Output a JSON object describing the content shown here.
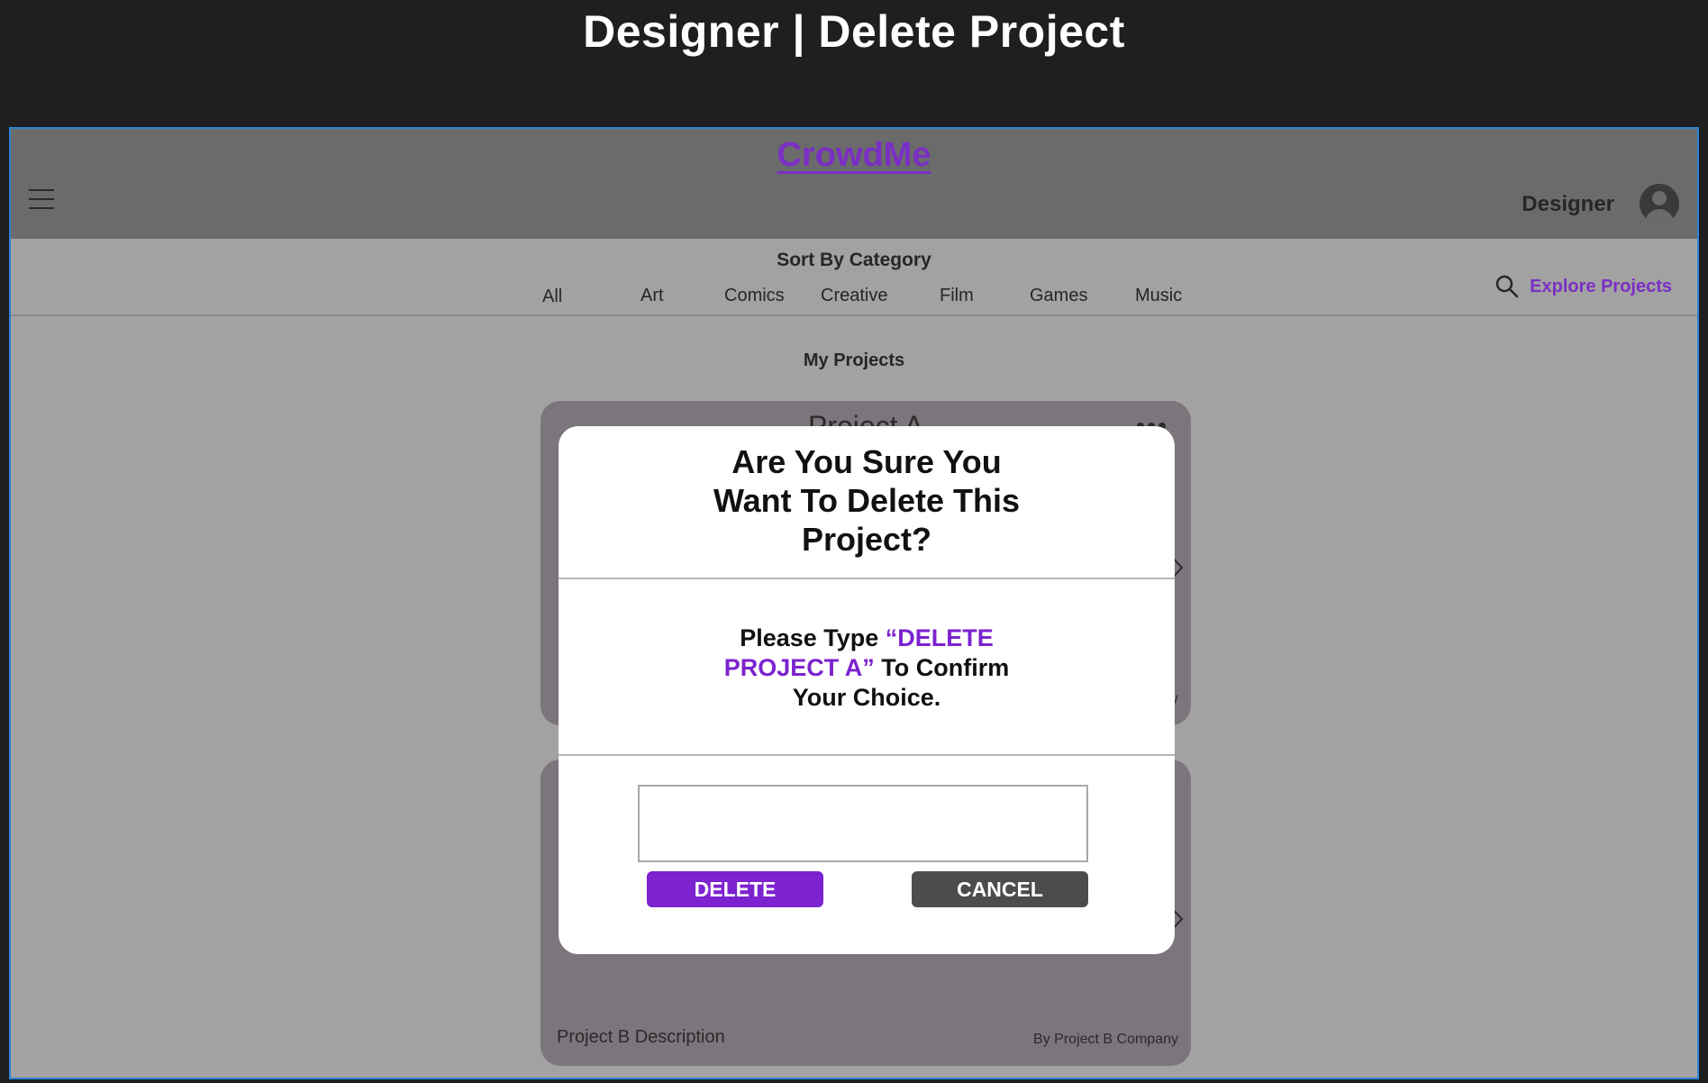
{
  "page_title": "Designer | Delete Project",
  "header": {
    "brand": "CrowdMe",
    "user_label": "Designer"
  },
  "categories": {
    "title": "Sort By Category",
    "items": [
      "All",
      "Art",
      "Comics",
      "Creative",
      "Film",
      "Games",
      "Music"
    ],
    "explore_label": "Explore Projects"
  },
  "main": {
    "section_title": "My Projects",
    "projects": [
      {
        "title": "Project A",
        "company_partial": "y"
      },
      {
        "description": "Project B Description",
        "company": "By Project B Company"
      }
    ]
  },
  "modal": {
    "title_lines": [
      "Are You Sure You",
      "Want To Delete This",
      "Project?"
    ],
    "instruction": {
      "line1_prefix": "Please Type ",
      "line1_highlight": "“DELETE",
      "line2_highlight": "PROJECT A”",
      "line2_suffix": " To Confirm",
      "line3": "Your Choice."
    },
    "input_value": "",
    "delete_label": "DELETE",
    "cancel_label": "CANCEL"
  },
  "colors": {
    "accent": "#7c22cf",
    "brand": "#7b2fc4",
    "cancel": "#4c4c4c",
    "frame_border": "#2d84d6"
  }
}
